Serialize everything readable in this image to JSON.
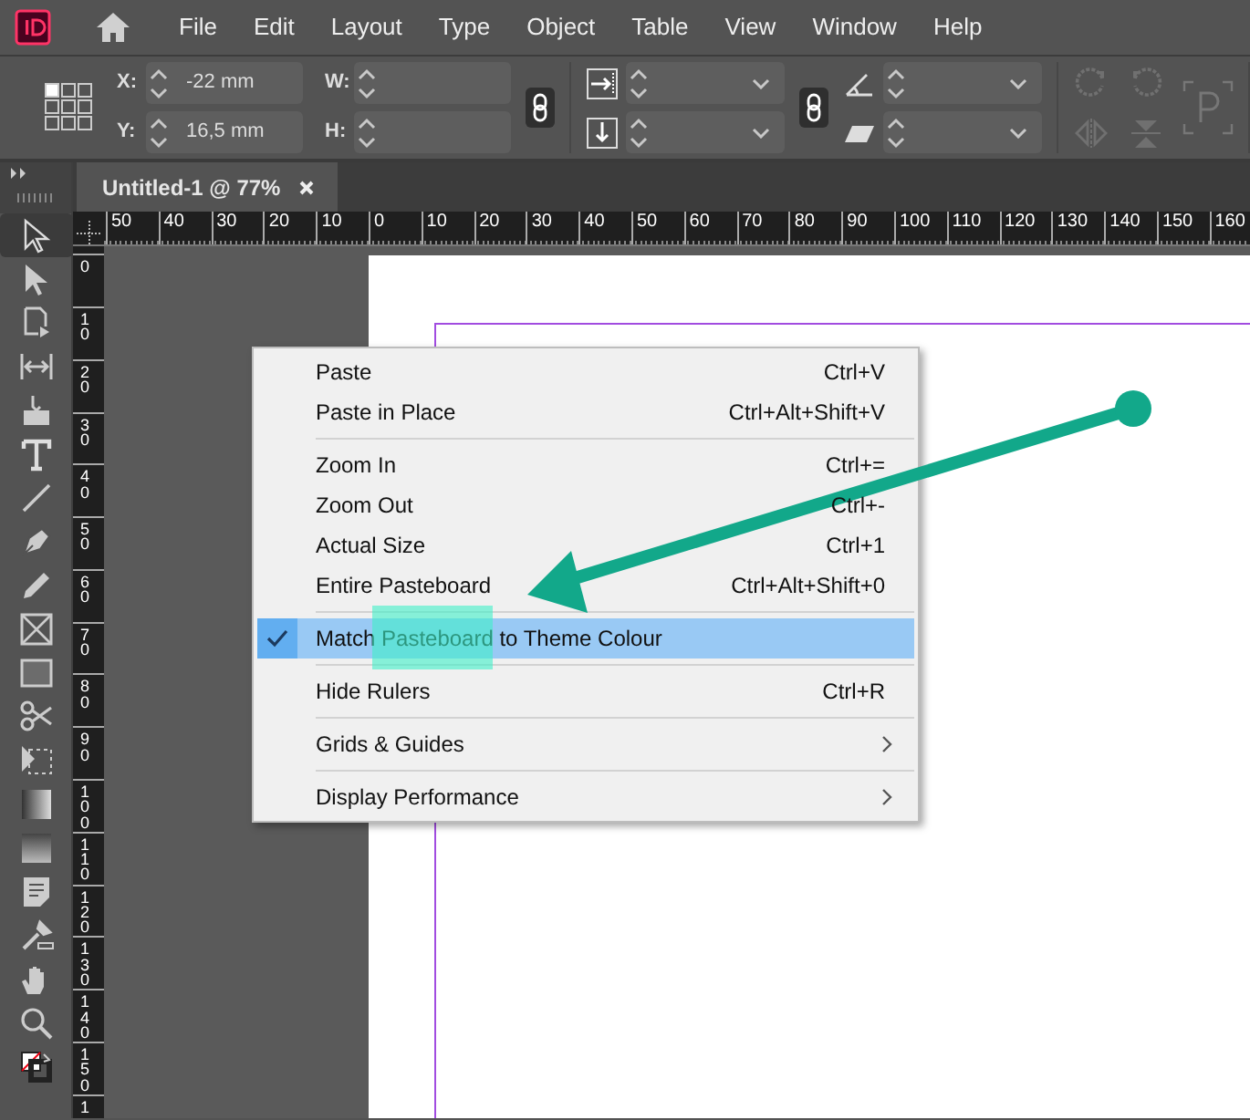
{
  "menu_bar": {
    "items": [
      "File",
      "Edit",
      "Layout",
      "Type",
      "Object",
      "Table",
      "View",
      "Window",
      "Help"
    ]
  },
  "control_panel": {
    "position_fields": [
      {
        "label": "X:",
        "value": "-22 mm"
      },
      {
        "label": "Y:",
        "value": "16,5 mm"
      }
    ],
    "size_fields": [
      {
        "label": "W:"
      },
      {
        "label": "H:"
      }
    ]
  },
  "document_tab": {
    "title": "Untitled-1 @ 77%"
  },
  "rulers": {
    "horizontal": [
      "50",
      "40",
      "30",
      "20",
      "10",
      "0",
      "10",
      "20",
      "30",
      "40",
      "50",
      "60",
      "70",
      "80",
      "90",
      "100",
      "110",
      "120",
      "130",
      "140",
      "150",
      "160"
    ],
    "vertical": [
      "0",
      "10",
      "20",
      "30",
      "40",
      "50",
      "60",
      "70",
      "80",
      "90",
      "100",
      "110",
      "120",
      "130",
      "140",
      "150",
      "1"
    ]
  },
  "context_menu": {
    "groups": [
      [
        {
          "label": "Paste",
          "shortcut": "Ctrl+V",
          "checked": false,
          "selected": false,
          "submenu": false
        },
        {
          "label": "Paste in Place",
          "shortcut": "Ctrl+Alt+Shift+V",
          "checked": false,
          "selected": false,
          "submenu": false
        }
      ],
      [
        {
          "label": "Zoom In",
          "shortcut": "Ctrl+=",
          "checked": false,
          "selected": false,
          "submenu": false
        },
        {
          "label": "Zoom Out",
          "shortcut": "Ctrl+-",
          "checked": false,
          "selected": false,
          "submenu": false
        },
        {
          "label": "Actual Size",
          "shortcut": "Ctrl+1",
          "checked": false,
          "selected": false,
          "submenu": false
        },
        {
          "label": "Entire Pasteboard",
          "shortcut": "Ctrl+Alt+Shift+0",
          "checked": false,
          "selected": false,
          "submenu": false
        }
      ],
      [
        {
          "label": "Match Pasteboard to Theme Colour",
          "checked": true,
          "selected": true,
          "submenu": false
        }
      ],
      [
        {
          "label": "Hide Rulers",
          "shortcut": "Ctrl+R",
          "checked": false,
          "selected": false,
          "submenu": false
        }
      ],
      [
        {
          "label": "Grids & Guides",
          "checked": false,
          "selected": false,
          "submenu": true
        }
      ],
      [
        {
          "label": "Display Performance",
          "checked": false,
          "selected": false,
          "submenu": true
        }
      ]
    ]
  }
}
